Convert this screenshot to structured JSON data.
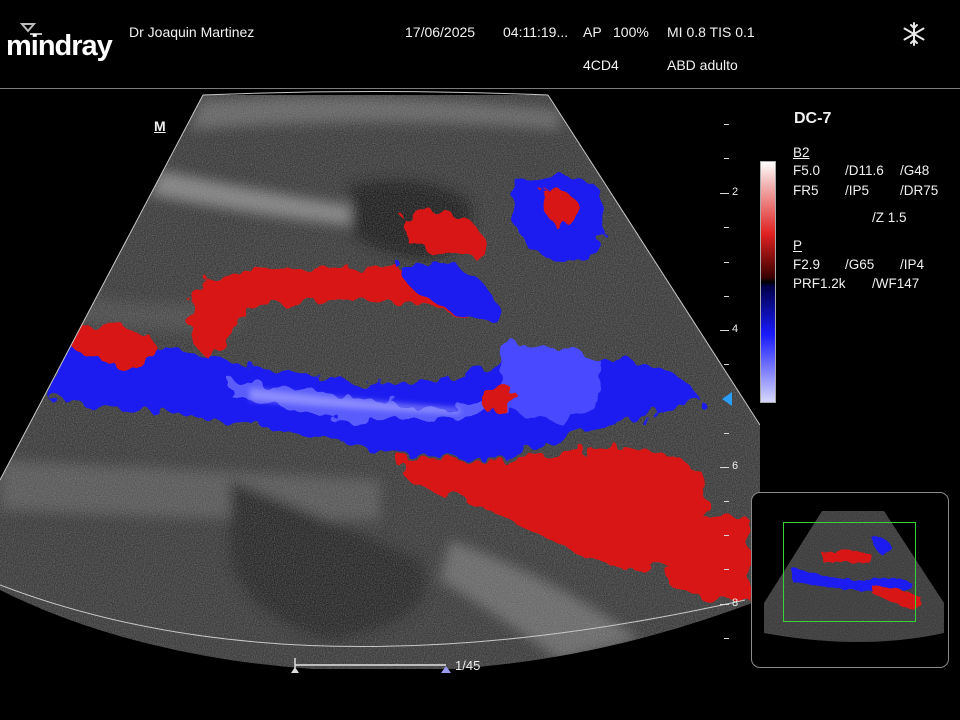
{
  "header": {
    "brand": "mindray",
    "operator": "Dr Joaquin Martinez",
    "date": "17/06/2025",
    "time": "04:11:19...",
    "ap": "AP",
    "ap_percent": "100%",
    "mi_tis": "MI 0.8 TIS 0.1",
    "preset_code": "4CD4",
    "exam": "ABD adulto",
    "freeze_icon": "snowflake-icon"
  },
  "image": {
    "orientation_marker": "M",
    "depth_labels": [
      "2",
      "4",
      "6",
      "8"
    ]
  },
  "params": {
    "probe": "DC-7",
    "b_mode": {
      "title": "B2",
      "row1": [
        "F5.0",
        "/D11.6",
        "/G48"
      ],
      "row2": [
        "FR5",
        "/IP5",
        "/DR75"
      ],
      "row3": [
        "/Z 1.5"
      ]
    },
    "color_mode": {
      "title": "P",
      "row1": [
        "F2.9",
        "/G65",
        "/IP4"
      ],
      "row2": [
        "PRF1.2k",
        "/WF147"
      ]
    }
  },
  "cine": {
    "frame": "1/45"
  },
  "colors": {
    "flow_red": "#d81818",
    "flow_blue": "#1c1cf0",
    "roi_box": "#35d335",
    "focus_marker": "#2a9df4"
  }
}
